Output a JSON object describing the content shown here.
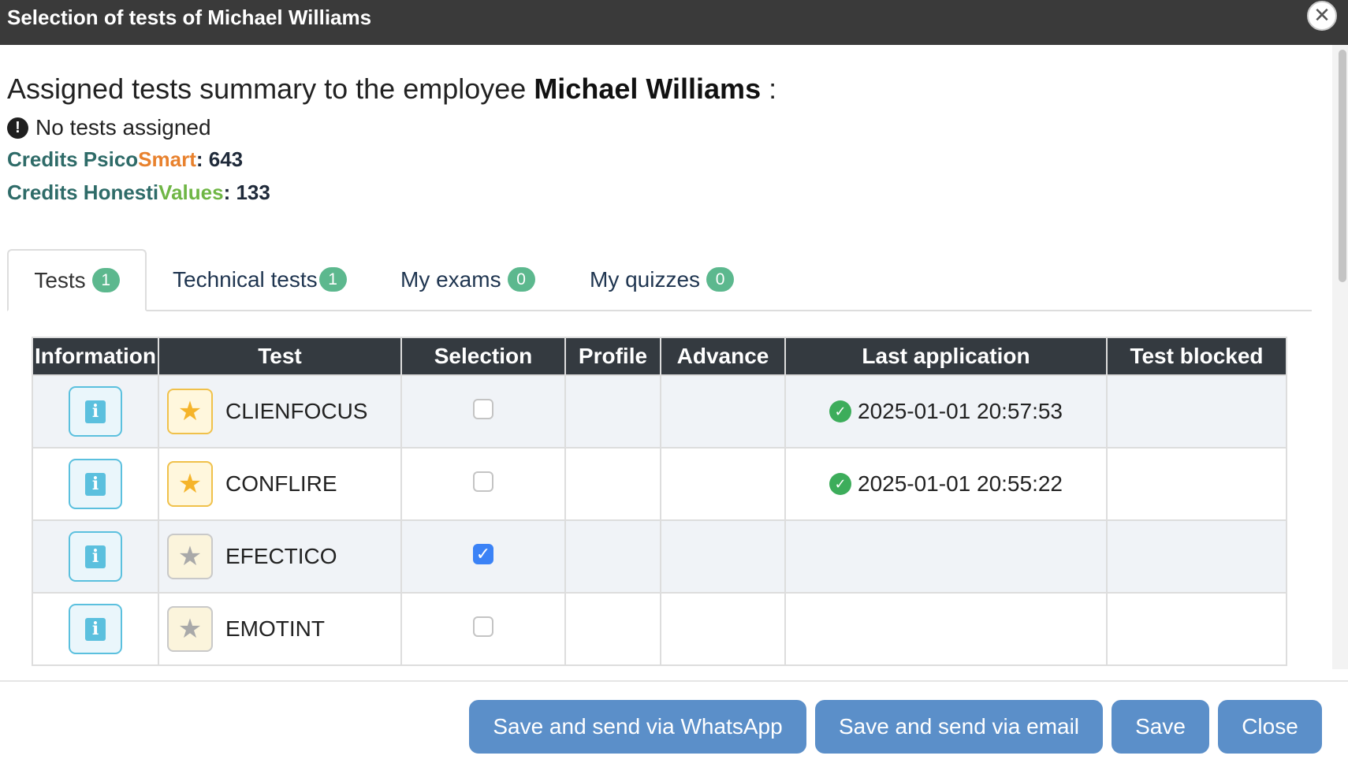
{
  "dialog": {
    "title": "Selection of tests of Michael Williams",
    "close_icon": "close-icon"
  },
  "summary": {
    "text": "Assigned tests summary to the employee ",
    "employee": "Michael Williams",
    "suffix": " :",
    "no_tests": "No tests assigned"
  },
  "credits": {
    "psicosmart": {
      "prefix": "Credits Psico",
      "highlight": "Smart",
      "value": ": 643"
    },
    "honestivalues": {
      "prefix": "Credits Honesti",
      "highlight": "Values",
      "value": ": 133"
    }
  },
  "tabs": [
    {
      "label": "Tests",
      "badge": "1",
      "active": true
    },
    {
      "label": "Technical tests",
      "badge": "1",
      "active": false
    },
    {
      "label": "My exams ",
      "badge": "0",
      "active": false
    },
    {
      "label": "My quizzes ",
      "badge": "0",
      "active": false
    }
  ],
  "table": {
    "headers": [
      "Information",
      "Test",
      "Selection",
      "Profile",
      "Advance",
      "Last application",
      "Test blocked"
    ],
    "rows": [
      {
        "test": "CLIENFOCUS",
        "starred": true,
        "selected": false,
        "profile": "",
        "advance": "",
        "last_application": "2025-01-01 20:57:53",
        "blocked": ""
      },
      {
        "test": "CONFLIRE",
        "starred": true,
        "selected": false,
        "profile": "",
        "advance": "",
        "last_application": "2025-01-01 20:55:22",
        "blocked": ""
      },
      {
        "test": "EFECTICO",
        "starred": false,
        "selected": true,
        "profile": "",
        "advance": "",
        "last_application": "",
        "blocked": ""
      },
      {
        "test": "EMOTINT",
        "starred": false,
        "selected": false,
        "profile": "",
        "advance": "",
        "last_application": "",
        "blocked": ""
      }
    ]
  },
  "footer": {
    "whatsapp": "Save and send via WhatsApp",
    "email": "Save and send via email",
    "save": "Save",
    "close": "Close"
  },
  "colors": {
    "titlebar": "#3a3a3a",
    "badge": "#5cb88e",
    "button": "#5b8fc9",
    "info": "#5bc0de",
    "star_active": "#f5b42a",
    "check": "#3b82f6"
  }
}
